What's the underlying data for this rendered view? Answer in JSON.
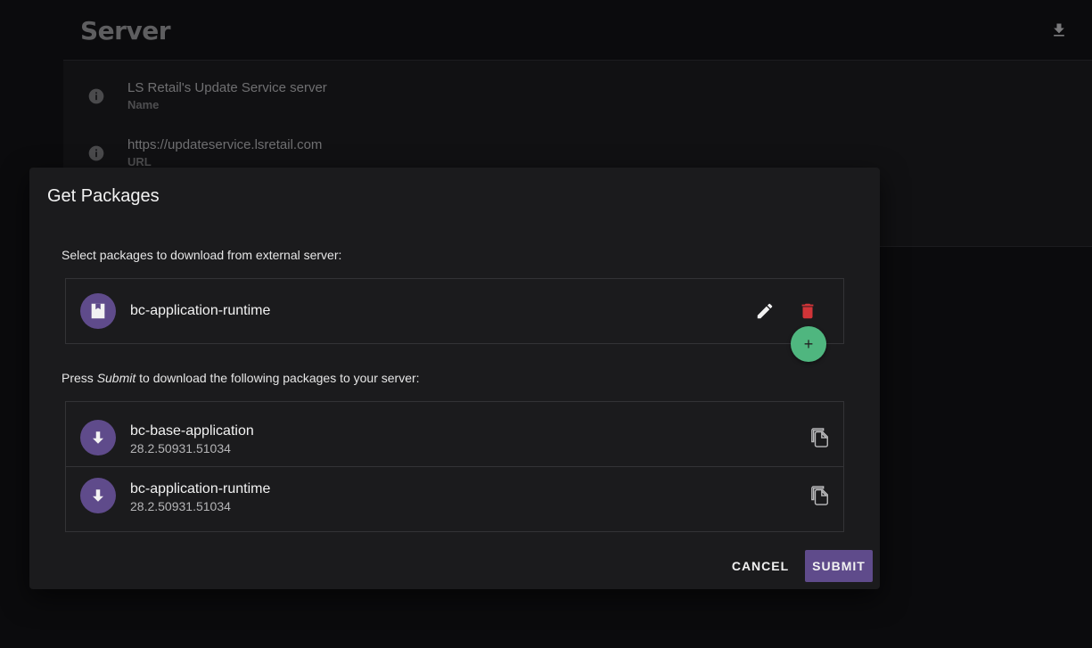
{
  "page": {
    "title": "Server",
    "fields": [
      {
        "value": "LS Retail's Update Service server",
        "label": "Name"
      },
      {
        "value": "https://updateservice.lsretail.com",
        "label": "URL"
      }
    ]
  },
  "dialog": {
    "title": "Get Packages",
    "select_label": "Select packages to download from external server:",
    "selected_packages": [
      {
        "name": "bc-application-runtime"
      }
    ],
    "download_label_prefix": "Press ",
    "download_label_emphasis": "Submit",
    "download_label_suffix": " to download the following packages to your server:",
    "download_packages": [
      {
        "name": "bc-base-application",
        "version": "28.2.50931.51034"
      },
      {
        "name": "bc-application-runtime",
        "version": "28.2.50931.51034"
      }
    ],
    "add_symbol": "+",
    "cancel_label": "CANCEL",
    "submit_label": "SUBMIT"
  },
  "colors": {
    "accent_purple": "#5f4b8b",
    "add_green": "#4fb67f",
    "delete_red": "#d13438"
  },
  "icons": [
    "download-icon",
    "info-icon",
    "package-icon",
    "edit-icon",
    "delete-icon",
    "add-icon",
    "arrow-down-icon",
    "copy-icon"
  ]
}
